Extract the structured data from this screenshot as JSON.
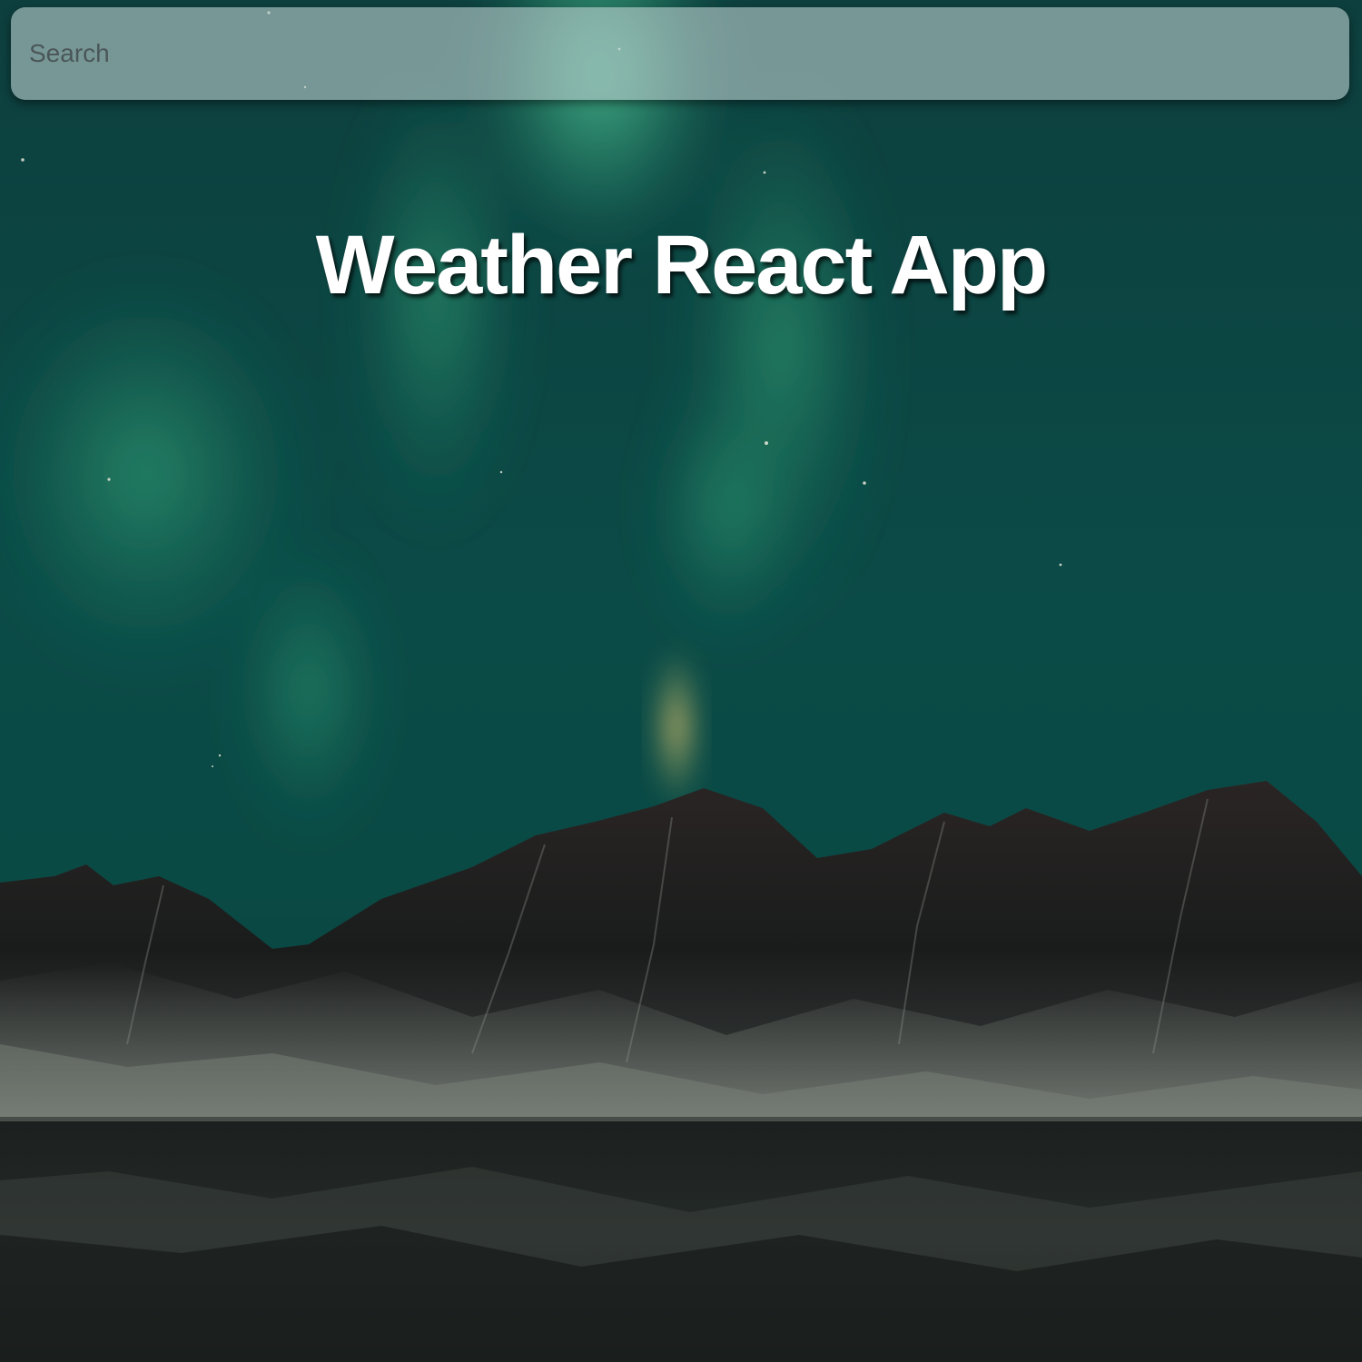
{
  "search": {
    "placeholder": "Search",
    "value": ""
  },
  "header": {
    "title": "Weather React App"
  },
  "background": {
    "scene": "aurora-over-mountains-icon",
    "colors": {
      "sky": "#0b4a47",
      "aurora": "#3fbf8a",
      "mountain": "#1a1a1a"
    }
  }
}
